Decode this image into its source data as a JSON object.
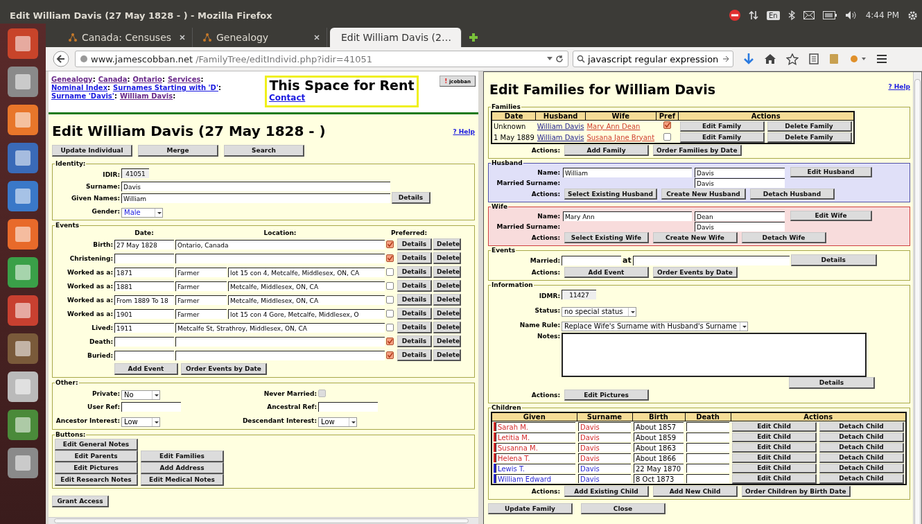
{
  "window": {
    "title": "Edit William Davis (27 May 1828 - ) - Mozilla Firefox"
  },
  "tray": {
    "language": "En",
    "time": "4:44 PM"
  },
  "tabs": [
    {
      "label": "Canada: Censuses",
      "selected": false
    },
    {
      "label": "Genealogy",
      "selected": false
    },
    {
      "label": "Edit William Davis (2…",
      "selected": true
    }
  ],
  "address_bar": {
    "host": "www.jamescobban.net",
    "path": "/FamilyTree/editIndivid.php?idir=41051"
  },
  "search_field": {
    "value": "javascript regular expression"
  },
  "individual": {
    "breadcrumbs": {
      "separator": ":",
      "items": [
        {
          "text": "Genealogy",
          "visited": true
        },
        {
          "text": "Canada",
          "visited": true
        },
        {
          "text": "Ontario",
          "visited": true
        },
        {
          "text": "Services",
          "visited": true
        },
        {
          "text": "Nominal Index",
          "visited": false
        },
        {
          "text": "Surnames Starting with 'D'",
          "visited": false
        },
        {
          "text": "Surname 'Davis'",
          "visited": false
        },
        {
          "text": "William Davis",
          "visited": true
        }
      ]
    },
    "ad": {
      "heading": "This Space for Rent",
      "link": "Contact"
    },
    "user_button": {
      "mark": "!",
      "name": "jcobban"
    },
    "title": "Edit William Davis (27 May 1828 - )",
    "help": "? Help",
    "actions": [
      "Update Individual",
      "Merge",
      "Search"
    ],
    "identity": {
      "legend": "Identity:",
      "idir_label": "IDIR:",
      "idir": "41051",
      "surname_label": "Surname:",
      "surname": "Davis",
      "given_label": "Given Names:",
      "given": "William",
      "details": "Details",
      "gender_label": "Gender:",
      "gender": "Male"
    },
    "events": {
      "legend": "Events",
      "columns": [
        "Date:",
        "Location:",
        "Preferred:"
      ],
      "rows": [
        {
          "kind": "plain",
          "label": "Birth:",
          "date": "27 May 1828",
          "location": "Ontario, Canada",
          "preferred": true,
          "buttons": [
            "Details",
            "Delete"
          ]
        },
        {
          "kind": "plain",
          "label": "Christening:",
          "preferred": true,
          "buttons": [
            "Details",
            "Delete"
          ]
        },
        {
          "kind": "occupation",
          "label": "Worked as a:",
          "date": "1871",
          "description": "Farmer",
          "location": "lot 15 con 4, Metcalfe, Middlesex, ON, CA",
          "preferred": false,
          "buttons": [
            "Details",
            "Delete"
          ]
        },
        {
          "kind": "occupation",
          "label": "Worked as a:",
          "date": "1881",
          "description": "Farmer",
          "location": "Metcalfe, Middlesex, ON, CA",
          "preferred": false,
          "buttons": [
            "Details",
            "Delete"
          ]
        },
        {
          "kind": "occupation",
          "label": "Worked as a:",
          "date": "From 1889 To 18",
          "description": "Farmer",
          "location": "Metcalfe, Middlesex, ON, CA",
          "preferred": false,
          "buttons": [
            "Details",
            "Delete"
          ]
        },
        {
          "kind": "occupation",
          "label": "Worked as a:",
          "date": "1901",
          "description": "Farmer",
          "location": "lot 15 con 4 Gore, Metcalfe, Middlesex, O",
          "preferred": false,
          "buttons": [
            "Details",
            "Delete"
          ]
        },
        {
          "kind": "plain",
          "label": "Lived:",
          "date": "1911",
          "location": "Metcalfe St, Strathroy, Middlesex, ON, CA",
          "preferred": false,
          "buttons": [
            "Details",
            "Delete"
          ]
        },
        {
          "kind": "plain",
          "label": "Death:",
          "preferred": true,
          "buttons": [
            "Details",
            "Delete"
          ]
        },
        {
          "kind": "plain",
          "label": "Buried:",
          "preferred": true,
          "buttons": [
            "Details",
            "Delete"
          ]
        }
      ],
      "buttons": [
        "Add Event",
        "Order Events by Date"
      ]
    },
    "other": {
      "legend": "Other:",
      "fields": [
        {
          "kind": "select",
          "label": "Private:",
          "value": "No"
        },
        {
          "kind": "checkbox",
          "label": "Never Married:",
          "checked": false,
          "disabled": true
        },
        {
          "kind": "text",
          "label": "User Ref:"
        },
        {
          "kind": "text",
          "label": "Ancestral Ref:"
        },
        {
          "kind": "select",
          "label": "Ancestor Interest:",
          "value": "Low"
        },
        {
          "kind": "select",
          "label": "Descendant Interest:",
          "value": "Low"
        }
      ]
    },
    "buttons_panel": {
      "legend": "Buttons:",
      "rows": [
        [
          "Edit General Notes"
        ],
        [
          "Edit Parents",
          "Edit Families"
        ],
        [
          "Edit Pictures",
          "Add Address"
        ],
        [
          "Edit Research Notes",
          "Edit Medical Notes"
        ]
      ]
    },
    "grant_access": "Grant Access"
  },
  "families_dialog": {
    "title": "Edit Families for William Davis",
    "help": "? Help",
    "families": {
      "legend": "Families",
      "columns": [
        "Date",
        "Husband",
        "Wife",
        "Pref",
        "Actions"
      ],
      "rows": [
        {
          "date": "Unknown",
          "husband": "William Davis",
          "wife": "Mary Ann Dean",
          "pref": true,
          "buttons": [
            "Edit Family",
            "Delete Family"
          ]
        },
        {
          "date": "1 May 1889",
          "husband": "William Davis",
          "wife": "Susana Jane Bryant",
          "pref": false,
          "buttons": [
            "Edit Family",
            "Delete Family"
          ]
        }
      ],
      "actions_label": "Actions:",
      "actions": [
        "Add Family",
        "Order Families by Date"
      ]
    },
    "spouses": [
      {
        "kind": "husband",
        "legend": "Husband",
        "name_label": "Name:",
        "given": "William",
        "surname": "Davis",
        "edit": "Edit Husband",
        "married_label": "Married Surname:",
        "married_surname": "Davis",
        "actions_label": "Actions:",
        "actions": [
          "Select Existing Husband",
          "Create New Husband",
          "Detach Husband"
        ]
      },
      {
        "kind": "wife",
        "legend": "Wife",
        "name_label": "Name:",
        "given": "Mary Ann",
        "surname": "Dean",
        "edit": "Edit Wife",
        "married_label": "Married Surname:",
        "married_surname": "Davis",
        "actions_label": "Actions:",
        "actions": [
          "Select Existing Wife",
          "Create New Wife",
          "Detach Wife"
        ]
      }
    ],
    "events": {
      "legend": "Events",
      "married_label": "Married:",
      "at": "at",
      "details": "Details",
      "actions_label": "Actions:",
      "actions": [
        "Add Event",
        "Order Events by Date"
      ]
    },
    "information": {
      "legend": "Information",
      "idmr_label": "IDMR:",
      "idmr": "11427",
      "status_label": "Status:",
      "status": "no special status",
      "rule_label": "Name Rule:",
      "rule": "Replace Wife's Surname with Husband's Surname",
      "notes_label": "Notes:",
      "details": "Details",
      "actions_label": "Actions:",
      "actions": [
        "Edit Pictures"
      ]
    },
    "children": {
      "legend": "Children",
      "columns": [
        "Given",
        "Surname",
        "Birth",
        "Death",
        "Actions"
      ],
      "rows": [
        {
          "given": "Sarah M.",
          "surname": "Davis",
          "birth": "About 1857",
          "color": "#d42a2a",
          "buttons": [
            "Edit Child",
            "Detach Child"
          ]
        },
        {
          "given": "Letitia M.",
          "surname": "Davis",
          "birth": "About 1859",
          "color": "#d42a2a",
          "buttons": [
            "Edit Child",
            "Detach Child"
          ]
        },
        {
          "given": "Susanna M.",
          "surname": "Davis",
          "birth": "About 1863",
          "color": "#d42a2a",
          "buttons": [
            "Edit Child",
            "Detach Child"
          ]
        },
        {
          "given": "Helena T.",
          "surname": "Davis",
          "birth": "About 1866",
          "color": "#d42a2a",
          "buttons": [
            "Edit Child",
            "Detach Child"
          ]
        },
        {
          "given": "Lewis T.",
          "surname": "Davis",
          "birth": "22 May 1870",
          "color": "#2a2ad4",
          "buttons": [
            "Edit Child",
            "Detach Child"
          ]
        },
        {
          "given": "William Edward",
          "surname": "Davis",
          "birth": "8 Oct 1873",
          "color": "#2a2ad4",
          "buttons": [
            "Edit Child",
            "Detach Child"
          ]
        }
      ],
      "actions_label": "Actions:",
      "actions": [
        "Add Existing Child",
        "Add New Child",
        "Order Children by Birth Date"
      ]
    },
    "footer": [
      "Update Family",
      "Close"
    ]
  }
}
